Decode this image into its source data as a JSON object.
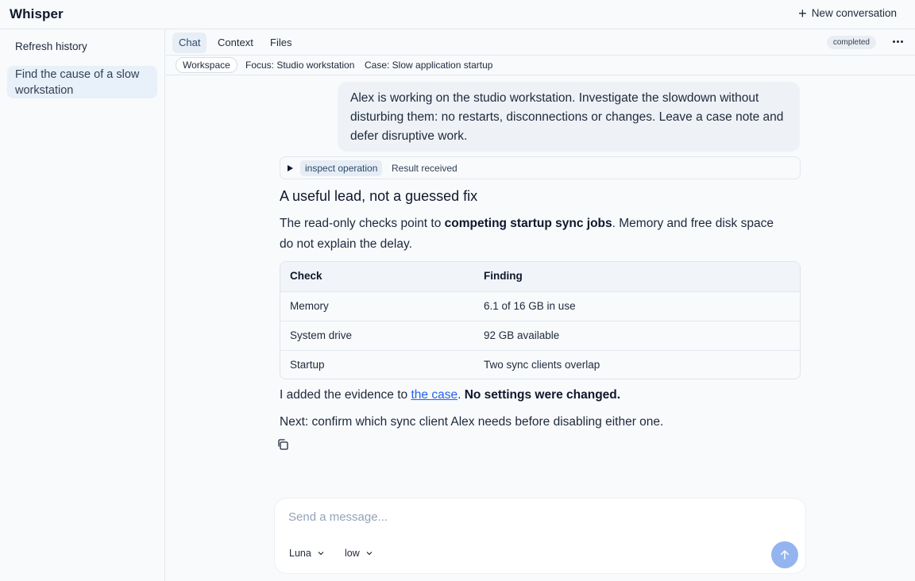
{
  "app": {
    "title": "Whisper",
    "new_conversation_label": "New conversation"
  },
  "sidebar": {
    "refresh_label": "Refresh history",
    "items": [
      {
        "label": "Find the cause of a slow workstation"
      }
    ]
  },
  "tabs": [
    {
      "label": "Chat",
      "active": true
    },
    {
      "label": "Context"
    },
    {
      "label": "Files"
    }
  ],
  "status": "completed",
  "context": {
    "workspace_label": "Workspace",
    "focus": "Focus: Studio workstation",
    "case": "Case: Slow application startup"
  },
  "conversation": {
    "user_message": "Alex is working on the studio workstation. Investigate the slowdown without disturbing them: no restarts, disconnections or changes. Leave a case note and defer disruptive work.",
    "tool_call": {
      "name": "inspect operation",
      "result": "Result received"
    },
    "answer": {
      "title": "A useful lead, not a guessed fix",
      "p1_pre": "The read-only checks point to ",
      "p1_bold": "competing startup sync jobs",
      "p1_post": ". Memory and free disk space do not explain the delay.",
      "table": {
        "headers": [
          "Check",
          "Finding"
        ],
        "rows": [
          [
            "Memory",
            "6.1 of 16 GB in use"
          ],
          [
            "System drive",
            "92 GB available"
          ],
          [
            "Startup",
            "Two sync clients overlap"
          ]
        ]
      },
      "p2_pre": "I added the evidence to ",
      "p2_link": "the case",
      "p2_mid": ". ",
      "p2_bold": "No settings were changed.",
      "p3": "Next: confirm which sync client Alex needs before disabling either one."
    }
  },
  "composer": {
    "placeholder": "Send a message...",
    "model": "Luna",
    "effort": "low"
  },
  "colors": {
    "accent": "#2563eb",
    "send_button": "#93b4ef",
    "active_tab": "#e8eef6"
  }
}
